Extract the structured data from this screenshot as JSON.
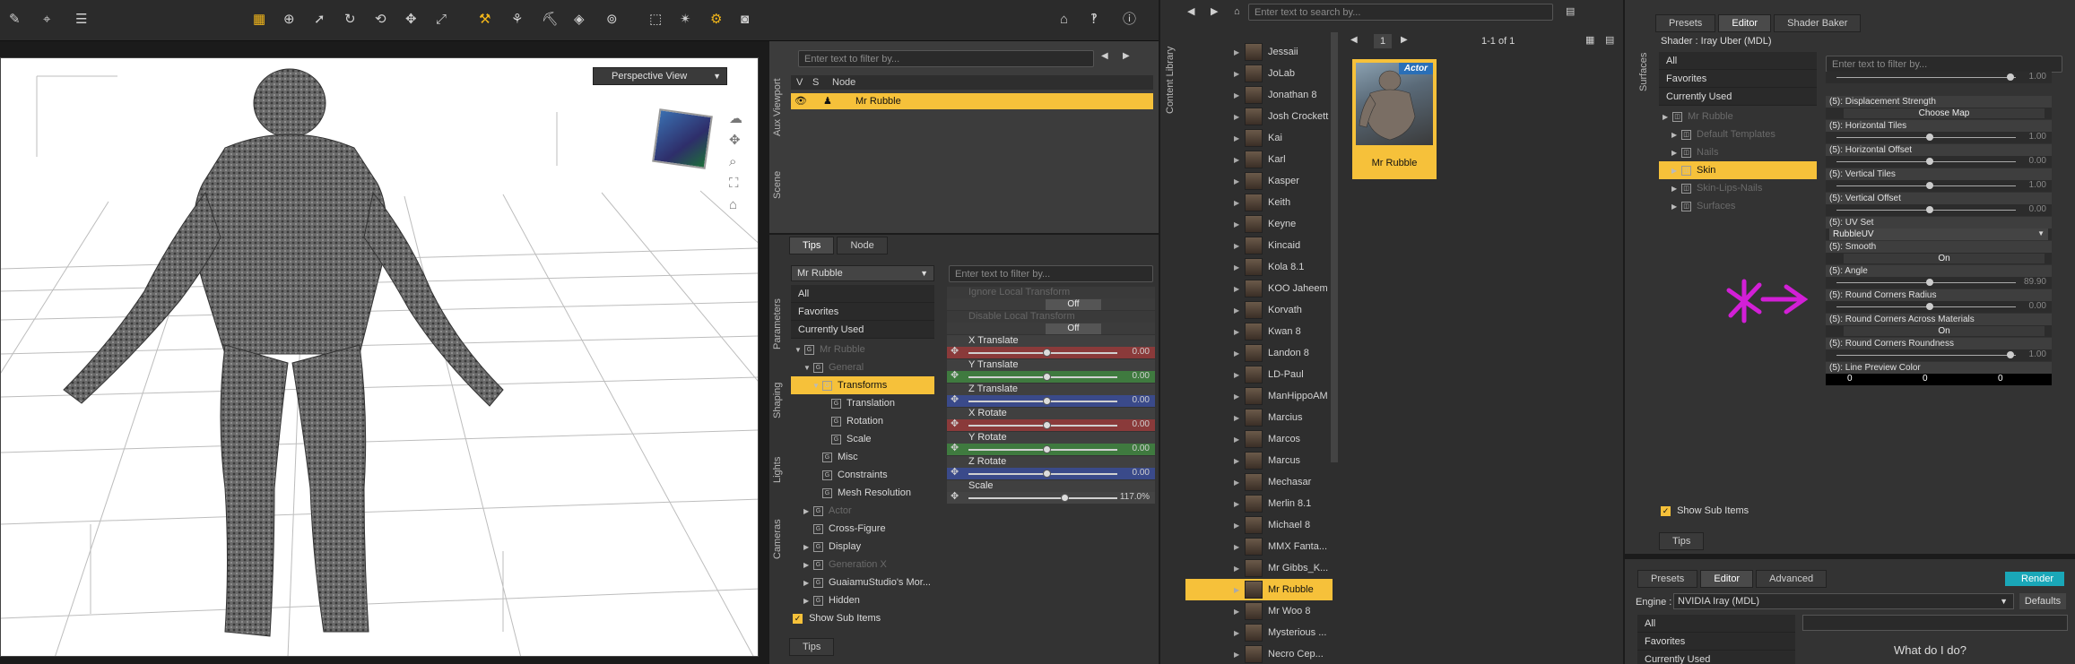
{
  "viewport": {
    "view_label": "Perspective View"
  },
  "scene": {
    "search_placeholder": "Enter text to filter by...",
    "col_v": "V",
    "col_s": "S",
    "col_node": "Node",
    "node": "Mr Rubble",
    "side_tabs": [
      "Aux Viewport",
      "Scene"
    ]
  },
  "params": {
    "tabs": [
      "Tips",
      "Node"
    ],
    "side_tabs": [
      "Parameters",
      "Shaping",
      "Lights",
      "Cameras"
    ],
    "dropdown": "Mr Rubble",
    "search_placeholder": "Enter text to filter by...",
    "list": [
      "All",
      "Favorites",
      "Currently Used"
    ],
    "tree": [
      {
        "label": "Mr Rubble",
        "level": 0,
        "dim": true,
        "arrow": "▼"
      },
      {
        "label": "General",
        "level": 1,
        "dim": true,
        "arrow": "▼"
      },
      {
        "label": "Transforms",
        "level": 2,
        "dim": false,
        "arrow": "▼",
        "selected": true
      },
      {
        "label": "Translation",
        "level": 3,
        "dim": false,
        "arrow": ""
      },
      {
        "label": "Rotation",
        "level": 3,
        "dim": false,
        "arrow": ""
      },
      {
        "label": "Scale",
        "level": 3,
        "dim": false,
        "arrow": ""
      },
      {
        "label": "Misc",
        "level": 2,
        "dim": false,
        "arrow": ""
      },
      {
        "label": "Constraints",
        "level": 2,
        "dim": false,
        "arrow": ""
      },
      {
        "label": "Mesh Resolution",
        "level": 2,
        "dim": false,
        "arrow": ""
      },
      {
        "label": "Actor",
        "level": 1,
        "dim": true,
        "arrow": "▶"
      },
      {
        "label": "Cross-Figure",
        "level": 1,
        "dim": false,
        "arrow": ""
      },
      {
        "label": "Display",
        "level": 1,
        "dim": false,
        "arrow": "▶"
      },
      {
        "label": "Generation X",
        "level": 1,
        "dim": true,
        "arrow": "▶"
      },
      {
        "label": "GuaiamuStudio's Mor...",
        "level": 1,
        "dim": false,
        "arrow": "▶"
      },
      {
        "label": "Hidden",
        "level": 1,
        "dim": false,
        "arrow": "▶"
      }
    ],
    "show_sub_items": "Show Sub Items",
    "bottom_tab": "Tips",
    "props": [
      {
        "label": "Ignore Local Transform",
        "dim": true,
        "button": "Off"
      },
      {
        "label": "Disable Local Transform",
        "dim": true,
        "button": "Off"
      },
      {
        "label": "X Translate",
        "value": "0.00",
        "color": "#8a3a3a",
        "knob": 0.5
      },
      {
        "label": "Y Translate",
        "value": "0.00",
        "color": "#3f7a3f",
        "knob": 0.5
      },
      {
        "label": "Z Translate",
        "value": "0.00",
        "color": "#3a4a8a",
        "knob": 0.5
      },
      {
        "label": "X Rotate",
        "value": "0.00",
        "color": "#8a3a3a",
        "knob": 0.5
      },
      {
        "label": "Y Rotate",
        "value": "0.00",
        "color": "#3f7a3f",
        "knob": 0.5
      },
      {
        "label": "Z Rotate",
        "value": "0.00",
        "color": "#3a4a8a",
        "knob": 0.5
      },
      {
        "label": "Scale",
        "value": "117.0%",
        "color": "#444444",
        "knob": 0.62
      }
    ]
  },
  "content_library": {
    "search_placeholder": "Enter text to search by...",
    "side_tab": "Content Library",
    "page_number": "1",
    "page_info": "1-1 of 1",
    "card_badge": "Actor",
    "card_label": "Mr Rubble",
    "items": [
      "Jessaii",
      "JoLab",
      "Jonathan 8",
      "Josh Crockett",
      "Kai",
      "Karl",
      "Kasper",
      "Keith",
      "Keyne",
      "Kincaid",
      "Kola 8.1",
      "KOO Jaheem",
      "Korvath",
      "Kwan 8",
      "Landon 8",
      "LD-Paul",
      "ManHippoAM",
      "Marcius",
      "Marcos",
      "Marcus",
      "Mechasar",
      "Merlin 8.1",
      "Michael 8",
      "MMX Fanta...",
      "Mr Gibbs_K...",
      "Mr Rubble",
      "Mr Woo 8",
      "Mysterious ...",
      "Necro Cep..."
    ],
    "selected": "Mr Rubble"
  },
  "surfaces": {
    "tabs": [
      "Presets",
      "Editor",
      "Shader Baker"
    ],
    "side_tab": "Surfaces",
    "shader": "Shader : Iray Uber (MDL)",
    "search_placeholder": "Enter text to filter by...",
    "list": [
      "All",
      "Favorites",
      "Currently Used"
    ],
    "tree": [
      {
        "label": "Mr Rubble",
        "dim": true,
        "level": 0
      },
      {
        "label": "Default Templates",
        "dim": true,
        "level": 1
      },
      {
        "label": "Nails",
        "dim": true,
        "level": 1
      },
      {
        "label": "Skin",
        "dim": false,
        "level": 1,
        "selected": true
      },
      {
        "label": "Skin-Lips-Nails",
        "dim": true,
        "level": 1
      },
      {
        "label": "Surfaces",
        "dim": true,
        "level": 1
      }
    ],
    "show_sub_items": "Show Sub Items",
    "bottom_tab": "Tips",
    "props": [
      {
        "label": "",
        "value": "1.00",
        "knob": 0.95,
        "partial": true
      },
      {
        "label": "(5): Displacement Strength",
        "button": "Choose Map"
      },
      {
        "label": "(5): Horizontal Tiles",
        "value": "1.00",
        "knob": 0.5
      },
      {
        "label": "(5): Horizontal Offset",
        "value": "0.00",
        "knob": 0.5
      },
      {
        "label": "(5): Vertical Tiles",
        "value": "1.00",
        "knob": 0.5
      },
      {
        "label": "(5): Vertical Offset",
        "value": "0.00",
        "knob": 0.5
      },
      {
        "label": "(5): UV Set",
        "select": "RubbleUV"
      },
      {
        "label": "(5): Smooth",
        "button": "On"
      },
      {
        "label": "(5): Angle",
        "value": "89.90",
        "knob": 0.5
      },
      {
        "label": "(5): Round Corners Radius",
        "value": "0.00",
        "knob": 0.5
      },
      {
        "label": "(5): Round Corners Across Materials",
        "button": "On"
      },
      {
        "label": "(5): Round Corners Roundness",
        "value": "1.00",
        "knob": 0.95
      },
      {
        "label": "(5): Line Preview Color",
        "color": [
          "0",
          "0",
          "0"
        ]
      }
    ]
  },
  "render": {
    "tabs": [
      "Presets",
      "Editor",
      "Advanced"
    ],
    "render_button": "Render",
    "engine_label": "Engine :",
    "engine": "NVIDIA Iray (MDL)",
    "defaults": "Defaults",
    "list": [
      "All",
      "Favorites",
      "Currently Used"
    ],
    "what_do_i_do": "What do I do?"
  },
  "annotation_color": "#d21fd6",
  "accent": "#f6c13a"
}
